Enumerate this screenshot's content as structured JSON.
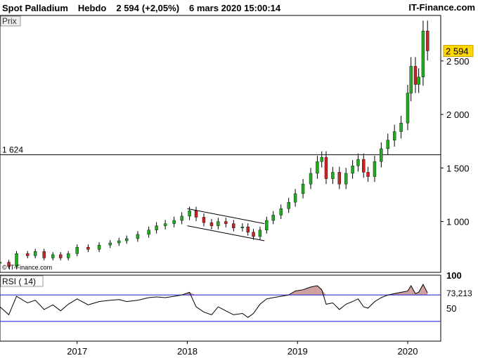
{
  "header": {
    "instrument": "Spot Palladium",
    "period": "Hebdo",
    "last_price": "2 594",
    "change": "(+2,05%)",
    "datetime": "6 mars 2020 15:00:14",
    "brand": "IT-Finance.com"
  },
  "chart_data": [
    {
      "type": "candlestick",
      "panel_label": "Prix",
      "watermark": "© IT-Finance.com",
      "y_ticks": [
        "2 500",
        "2 000",
        "1 500",
        "1 000"
      ],
      "x_ticks": [
        "2017",
        "2018",
        "2019",
        "2020"
      ],
      "ylim": [
        525,
        2925
      ],
      "xlim": [
        2016.3,
        2020.3
      ],
      "last_value_label": "2 594",
      "horizontal_line": {
        "value": 1624,
        "label": "1 624"
      },
      "channel_lines": [
        {
          "from": [
            2018.0,
            1120
          ],
          "to": [
            2018.7,
            980
          ]
        },
        {
          "from": [
            2018.0,
            960
          ],
          "to": [
            2018.7,
            820
          ]
        }
      ],
      "colors": {
        "up": "#22aa22",
        "down": "#cc2222",
        "last_label_bg": "#ffd700",
        "wick": "#000000"
      },
      "series": [
        {
          "t": 2016.3,
          "v": 620
        },
        {
          "t": 2016.38,
          "v": 580
        },
        {
          "t": 2016.45,
          "v": 700
        },
        {
          "t": 2016.55,
          "v": 680
        },
        {
          "t": 2016.62,
          "v": 720
        },
        {
          "t": 2016.7,
          "v": 660
        },
        {
          "t": 2016.78,
          "v": 690
        },
        {
          "t": 2016.85,
          "v": 660
        },
        {
          "t": 2016.92,
          "v": 700
        },
        {
          "t": 2017.0,
          "v": 760
        },
        {
          "t": 2017.1,
          "v": 740
        },
        {
          "t": 2017.2,
          "v": 780
        },
        {
          "t": 2017.3,
          "v": 800
        },
        {
          "t": 2017.38,
          "v": 820
        },
        {
          "t": 2017.45,
          "v": 840
        },
        {
          "t": 2017.55,
          "v": 880
        },
        {
          "t": 2017.65,
          "v": 920
        },
        {
          "t": 2017.72,
          "v": 960
        },
        {
          "t": 2017.8,
          "v": 980
        },
        {
          "t": 2017.88,
          "v": 1010
        },
        {
          "t": 2017.95,
          "v": 1050
        },
        {
          "t": 2018.02,
          "v": 1100
        },
        {
          "t": 2018.08,
          "v": 1040
        },
        {
          "t": 2018.15,
          "v": 990
        },
        {
          "t": 2018.22,
          "v": 960
        },
        {
          "t": 2018.28,
          "v": 1000
        },
        {
          "t": 2018.35,
          "v": 980
        },
        {
          "t": 2018.42,
          "v": 940
        },
        {
          "t": 2018.5,
          "v": 950
        },
        {
          "t": 2018.55,
          "v": 900
        },
        {
          "t": 2018.6,
          "v": 860
        },
        {
          "t": 2018.66,
          "v": 920
        },
        {
          "t": 2018.72,
          "v": 1010
        },
        {
          "t": 2018.78,
          "v": 1060
        },
        {
          "t": 2018.85,
          "v": 1120
        },
        {
          "t": 2018.92,
          "v": 1180
        },
        {
          "t": 2018.98,
          "v": 1260
        },
        {
          "t": 2019.05,
          "v": 1350
        },
        {
          "t": 2019.12,
          "v": 1450
        },
        {
          "t": 2019.18,
          "v": 1560
        },
        {
          "t": 2019.22,
          "v": 1600
        },
        {
          "t": 2019.26,
          "v": 1400
        },
        {
          "t": 2019.32,
          "v": 1460
        },
        {
          "t": 2019.38,
          "v": 1350
        },
        {
          "t": 2019.44,
          "v": 1450
        },
        {
          "t": 2019.5,
          "v": 1520
        },
        {
          "t": 2019.55,
          "v": 1580
        },
        {
          "t": 2019.6,
          "v": 1460
        },
        {
          "t": 2019.64,
          "v": 1420
        },
        {
          "t": 2019.7,
          "v": 1560
        },
        {
          "t": 2019.76,
          "v": 1680
        },
        {
          "t": 2019.82,
          "v": 1760
        },
        {
          "t": 2019.88,
          "v": 1840
        },
        {
          "t": 2019.94,
          "v": 1920
        },
        {
          "t": 2020.0,
          "v": 2200
        },
        {
          "t": 2020.03,
          "v": 2450
        },
        {
          "t": 2020.07,
          "v": 2280
        },
        {
          "t": 2020.1,
          "v": 2350
        },
        {
          "t": 2020.14,
          "v": 2780
        },
        {
          "t": 2020.18,
          "v": 2594
        }
      ]
    },
    {
      "type": "line",
      "panel_label": "RSI ( 14)",
      "y_ticks": [
        "100",
        "50"
      ],
      "ylim": [
        0,
        100
      ],
      "levels": [
        70,
        30
      ],
      "last_value_label": "73,213",
      "colors": {
        "line": "#000000",
        "level": "#2f2fdc",
        "overbought_fill": "#cfa0a0"
      },
      "series": [
        {
          "t": 2016.3,
          "v": 52
        },
        {
          "t": 2016.38,
          "v": 40
        },
        {
          "t": 2016.45,
          "v": 68
        },
        {
          "t": 2016.55,
          "v": 58
        },
        {
          "t": 2016.62,
          "v": 62
        },
        {
          "t": 2016.7,
          "v": 48
        },
        {
          "t": 2016.78,
          "v": 55
        },
        {
          "t": 2016.85,
          "v": 46
        },
        {
          "t": 2016.92,
          "v": 56
        },
        {
          "t": 2017.0,
          "v": 64
        },
        {
          "t": 2017.1,
          "v": 55
        },
        {
          "t": 2017.2,
          "v": 60
        },
        {
          "t": 2017.3,
          "v": 62
        },
        {
          "t": 2017.38,
          "v": 63
        },
        {
          "t": 2017.45,
          "v": 60
        },
        {
          "t": 2017.55,
          "v": 62
        },
        {
          "t": 2017.65,
          "v": 66
        },
        {
          "t": 2017.72,
          "v": 67
        },
        {
          "t": 2017.8,
          "v": 66
        },
        {
          "t": 2017.88,
          "v": 68
        },
        {
          "t": 2017.95,
          "v": 70
        },
        {
          "t": 2018.02,
          "v": 74
        },
        {
          "t": 2018.08,
          "v": 52
        },
        {
          "t": 2018.15,
          "v": 44
        },
        {
          "t": 2018.22,
          "v": 40
        },
        {
          "t": 2018.28,
          "v": 52
        },
        {
          "t": 2018.35,
          "v": 46
        },
        {
          "t": 2018.42,
          "v": 40
        },
        {
          "t": 2018.5,
          "v": 42
        },
        {
          "t": 2018.55,
          "v": 36
        },
        {
          "t": 2018.6,
          "v": 42
        },
        {
          "t": 2018.66,
          "v": 56
        },
        {
          "t": 2018.72,
          "v": 64
        },
        {
          "t": 2018.78,
          "v": 66
        },
        {
          "t": 2018.85,
          "v": 68
        },
        {
          "t": 2018.92,
          "v": 70
        },
        {
          "t": 2018.98,
          "v": 76
        },
        {
          "t": 2019.05,
          "v": 78
        },
        {
          "t": 2019.12,
          "v": 82
        },
        {
          "t": 2019.18,
          "v": 84
        },
        {
          "t": 2019.22,
          "v": 78
        },
        {
          "t": 2019.26,
          "v": 56
        },
        {
          "t": 2019.32,
          "v": 58
        },
        {
          "t": 2019.38,
          "v": 48
        },
        {
          "t": 2019.44,
          "v": 56
        },
        {
          "t": 2019.5,
          "v": 60
        },
        {
          "t": 2019.55,
          "v": 64
        },
        {
          "t": 2019.6,
          "v": 52
        },
        {
          "t": 2019.64,
          "v": 50
        },
        {
          "t": 2019.7,
          "v": 60
        },
        {
          "t": 2019.76,
          "v": 66
        },
        {
          "t": 2019.82,
          "v": 70
        },
        {
          "t": 2019.88,
          "v": 72
        },
        {
          "t": 2019.94,
          "v": 74
        },
        {
          "t": 2020.0,
          "v": 76
        },
        {
          "t": 2020.03,
          "v": 84
        },
        {
          "t": 2020.07,
          "v": 72
        },
        {
          "t": 2020.1,
          "v": 74
        },
        {
          "t": 2020.14,
          "v": 86
        },
        {
          "t": 2020.18,
          "v": 73.213
        }
      ]
    }
  ]
}
